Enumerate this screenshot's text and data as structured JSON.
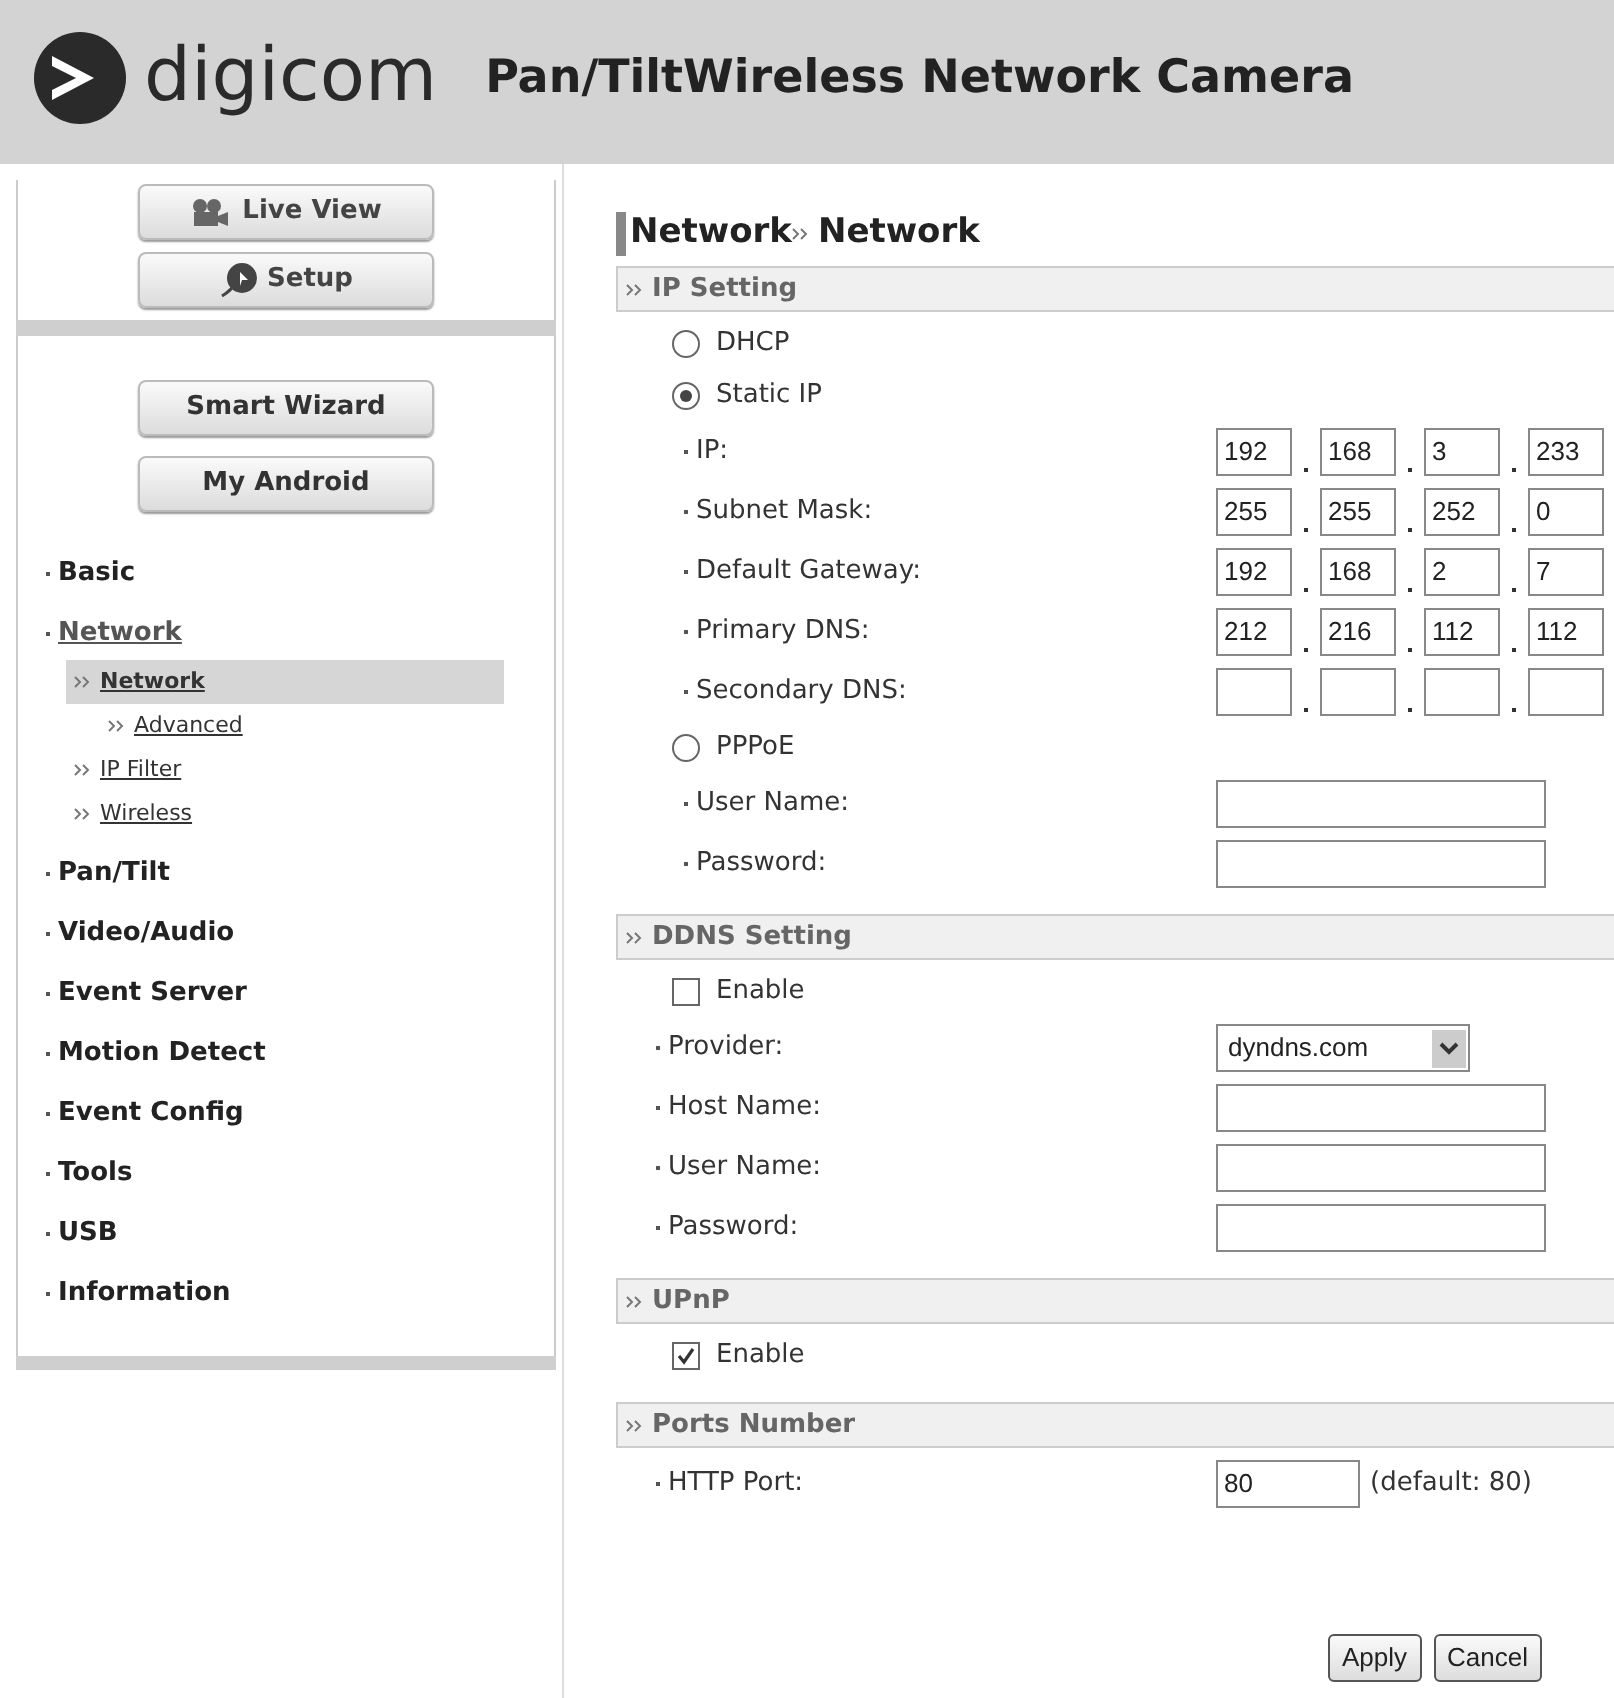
{
  "header": {
    "logo_text": "digicom",
    "title": "Pan/TiltWireless Network Camera"
  },
  "nav_buttons": [
    {
      "kind": "live",
      "label": "Live View"
    },
    {
      "kind": "setup",
      "label": "Setup"
    }
  ],
  "wizard_buttons": [
    "Smart Wizard",
    "My Android"
  ],
  "menu": [
    {
      "label": "Basic",
      "expanded": false
    },
    {
      "label": "Network",
      "expanded": true,
      "children": [
        {
          "label": "Network",
          "selected": true,
          "children": [
            {
              "label": "Advanced",
              "selected": false
            }
          ]
        },
        {
          "label": "IP Filter",
          "selected": false
        },
        {
          "label": "Wireless",
          "selected": false
        }
      ]
    },
    {
      "label": "Pan/Tilt",
      "expanded": false
    },
    {
      "label": "Video/Audio",
      "expanded": false
    },
    {
      "label": "Event Server",
      "expanded": false
    },
    {
      "label": "Motion Detect",
      "expanded": false
    },
    {
      "label": "Event Config",
      "expanded": false
    },
    {
      "label": "Tools",
      "expanded": false
    },
    {
      "label": "USB",
      "expanded": false
    },
    {
      "label": "Information",
      "expanded": false
    }
  ],
  "page_title": {
    "section": "Network",
    "page": "Network"
  },
  "sections": [
    {
      "title": "IP Setting",
      "rows": [
        {
          "kind": "radio",
          "label": "DHCP",
          "selected": false
        },
        {
          "kind": "radio",
          "label": "Static IP",
          "selected": true
        },
        {
          "kind": "ip",
          "label": "IP:",
          "octets": [
            "192",
            "168",
            "3",
            "233"
          ]
        },
        {
          "kind": "ip",
          "label": "Subnet Mask:",
          "octets": [
            "255",
            "255",
            "252",
            "0"
          ]
        },
        {
          "kind": "ip",
          "label": "Default Gateway:",
          "octets": [
            "192",
            "168",
            "2",
            "7"
          ]
        },
        {
          "kind": "ip",
          "label": "Primary DNS:",
          "octets": [
            "212",
            "216",
            "112",
            "112"
          ]
        },
        {
          "kind": "ip",
          "label": "Secondary DNS:"
        },
        {
          "kind": "radio",
          "label": "PPPoE",
          "selected": false
        },
        {
          "kind": "text",
          "label": "User Name:"
        },
        {
          "kind": "text",
          "label": "Password:"
        }
      ]
    },
    {
      "title": "DDNS Setting",
      "rows": [
        {
          "kind": "checkbox",
          "label": "Enable",
          "checked": false
        },
        {
          "kind": "select",
          "label": "Provider:",
          "value": "dyndns.com"
        },
        {
          "kind": "text",
          "label": "Host Name:"
        },
        {
          "kind": "text",
          "label": "User Name:"
        },
        {
          "kind": "text",
          "label": "Password:"
        }
      ]
    },
    {
      "title": "UPnP",
      "rows": [
        {
          "kind": "checkbox",
          "label": "Enable",
          "checked": true
        }
      ]
    },
    {
      "title": "Ports Number",
      "rows": [
        {
          "kind": "port",
          "label": "HTTP Port:",
          "value": "80",
          "hint": "(default: 80)"
        }
      ]
    }
  ],
  "buttons": [
    "Apply",
    "Cancel"
  ]
}
